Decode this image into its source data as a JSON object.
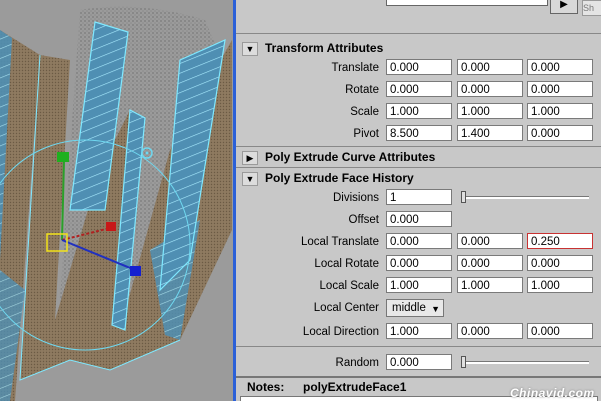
{
  "top_buttons": {
    "play": "▶",
    "show": "Sh"
  },
  "sections": {
    "transform": "Transform Attributes",
    "curve": "Poly Extrude Curve Attributes",
    "history": "Poly Extrude Face History"
  },
  "transform_attrs": [
    {
      "label": "Translate",
      "values": [
        "0.000",
        "0.000",
        "0.000"
      ]
    },
    {
      "label": "Rotate",
      "values": [
        "0.000",
        "0.000",
        "0.000"
      ]
    },
    {
      "label": "Scale",
      "values": [
        "1.000",
        "1.000",
        "1.000"
      ]
    },
    {
      "label": "Pivot",
      "values": [
        "8.500",
        "1.400",
        "0.000"
      ]
    }
  ],
  "history_attrs": {
    "divisions": {
      "label": "Divisions",
      "value": "1"
    },
    "offset": {
      "label": "Offset",
      "value": "0.000"
    },
    "local_translate": {
      "label": "Local Translate",
      "values": [
        "0.000",
        "0.000",
        "0.250"
      ]
    },
    "local_rotate": {
      "label": "Local Rotate",
      "values": [
        "0.000",
        "0.000",
        "0.000"
      ]
    },
    "local_scale": {
      "label": "Local Scale",
      "values": [
        "1.000",
        "1.000",
        "1.000"
      ]
    },
    "local_center": {
      "label": "Local Center",
      "value": "middle"
    },
    "local_direction": {
      "label": "Local Direction",
      "values": [
        "1.000",
        "0.000",
        "0.000"
      ]
    },
    "random": {
      "label": "Random",
      "value": "0.000"
    }
  },
  "notes": {
    "label": "Notes:",
    "value": "polyExtrudeFace1"
  },
  "watermark": "Chinavid.com"
}
